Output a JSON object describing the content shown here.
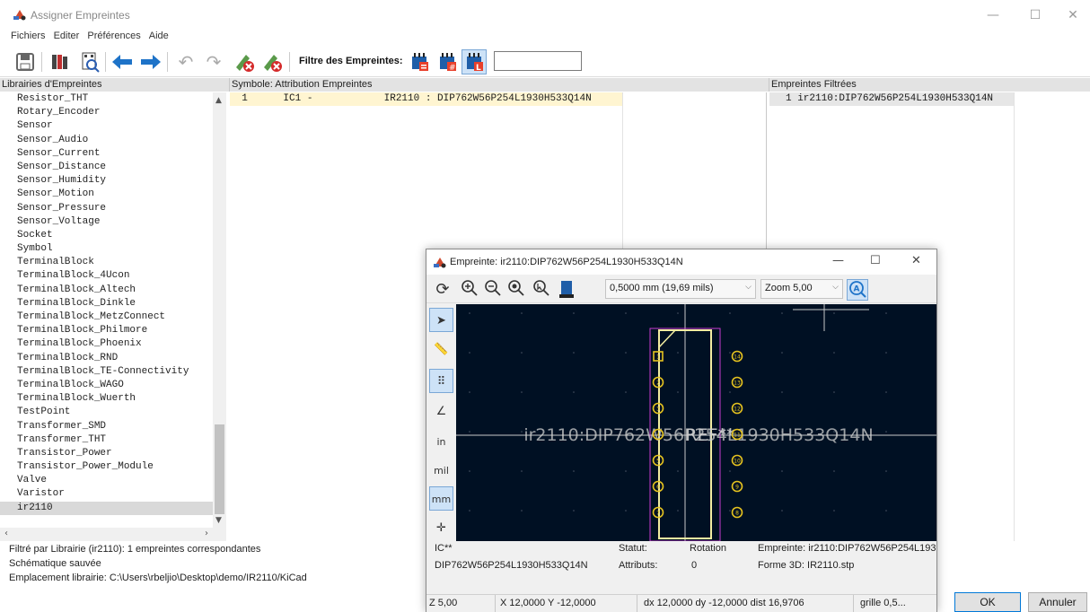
{
  "window": {
    "title": "Assigner Empreintes",
    "minimize": "—",
    "maximize": "☐",
    "close": "✕"
  },
  "menu": [
    "Fichiers",
    "Editer",
    "Préférences",
    "Aide"
  ],
  "toolbar": {
    "filter_label": "Filtre des Empreintes:",
    "filter_value": ""
  },
  "panels": {
    "libraries_header": "Librairies d'Empreintes",
    "symbols_header": "Symbole: Attribution Empreintes",
    "filtered_header": "Empreintes Filtrées"
  },
  "libraries": [
    "Resistor_THT",
    "Rotary_Encoder",
    "Sensor",
    "Sensor_Audio",
    "Sensor_Current",
    "Sensor_Distance",
    "Sensor_Humidity",
    "Sensor_Motion",
    "Sensor_Pressure",
    "Sensor_Voltage",
    "Socket",
    "Symbol",
    "TerminalBlock",
    "TerminalBlock_4Ucon",
    "TerminalBlock_Altech",
    "TerminalBlock_Dinkle",
    "TerminalBlock_MetzConnect",
    "TerminalBlock_Philmore",
    "TerminalBlock_Phoenix",
    "TerminalBlock_RND",
    "TerminalBlock_TE-Connectivity",
    "TerminalBlock_WAGO",
    "TerminalBlock_Wuerth",
    "TestPoint",
    "Transformer_SMD",
    "Transformer_THT",
    "Transistor_Power",
    "Transistor_Power_Module",
    "Valve",
    "Varistor",
    "ir2110"
  ],
  "symbol_row": "  1      IC1 -            IR2110 : DIP762W56P254L1930H533Q14N",
  "filtered_row": "1 ir2110:DIP762W56P254L1930H533Q14N",
  "status": {
    "line1": "Filtré par Librairie (ir2110): 1 empreintes correspondantes",
    "line2": "Schématique sauvée",
    "line3": "Emplacement librairie: C:\\Users\\rbeljio\\Desktop\\demo/IR2110/KiCad"
  },
  "buttons": {
    "ok": "OK",
    "cancel": "Annuler"
  },
  "viewer": {
    "title": "Empreinte: ir2110:DIP762W56P254L1930H533Q14N",
    "grid_select": "0,5000 mm (19,69 mils)",
    "zoom_select": "Zoom 5,00",
    "canvas_text": "ir2110:DIP762W56P254L1930H533Q14N",
    "canvas_ref": "REF**",
    "pins_left": [
      "1",
      "2",
      "3",
      "4",
      "5",
      "6",
      "7"
    ],
    "pins_right": [
      "14",
      "13",
      "12",
      "11",
      "10",
      "9",
      "8"
    ],
    "msg": {
      "ref": "IC**",
      "footprint_name": "DIP762W56P254L1930H533Q14N",
      "statut_label": "Statut:",
      "rotation_label": "Rotation",
      "attributs_label": "Attributs:",
      "attributs_value": "0",
      "empreinte": "Empreinte: ir2110:DIP762W56P254L193",
      "forme3d": "Forme 3D: IR2110.stp"
    },
    "statusbar": {
      "zoom": "Z 5,00",
      "xy": "X 12,0000  Y -12,0000",
      "dxdy": "dx 12,0000  dy -12,0000  dist 16,9706",
      "grid": "grille 0,5..."
    }
  }
}
